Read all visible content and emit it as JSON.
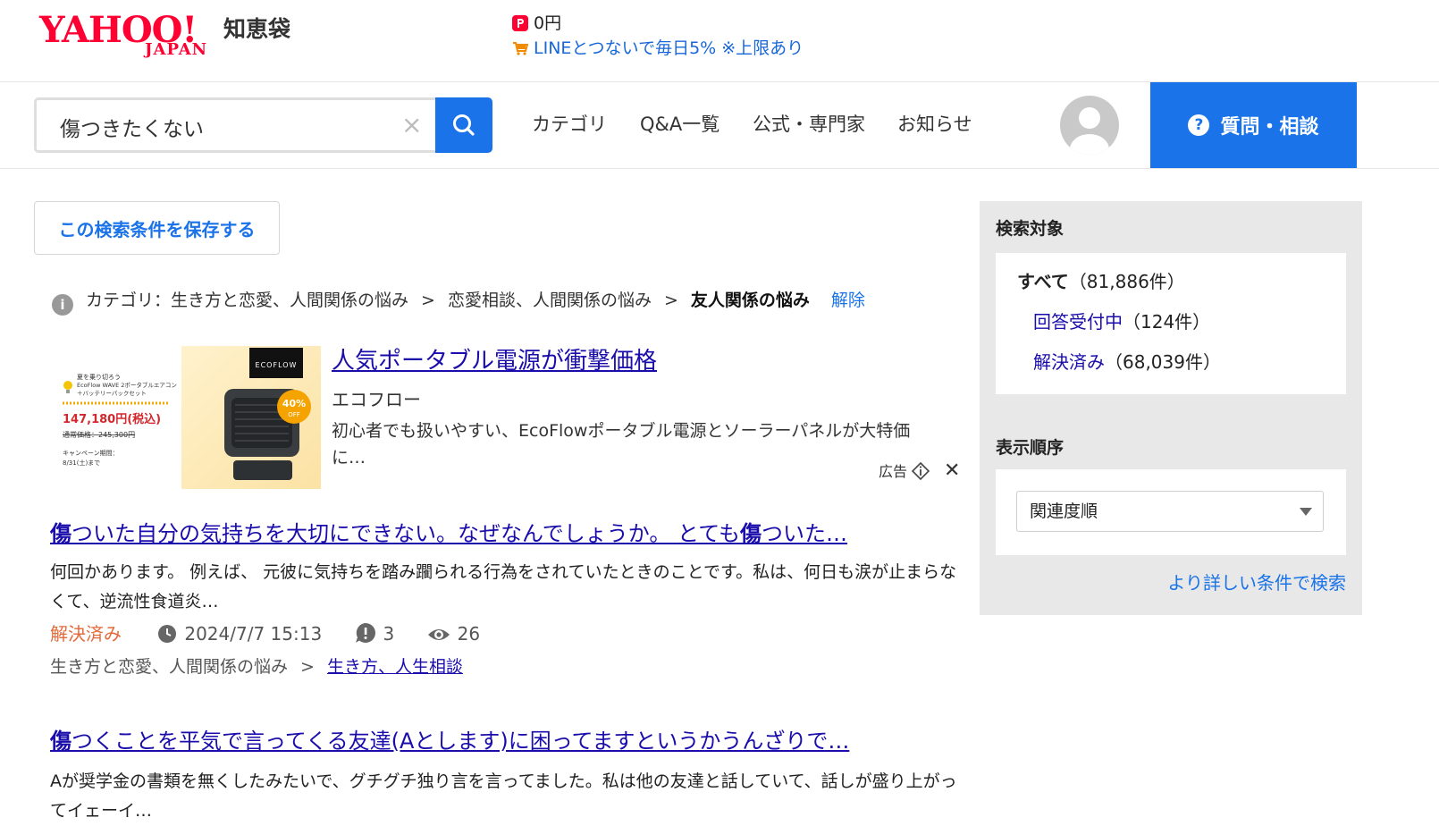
{
  "brand": {
    "logo_text": "YAHOO!",
    "logo_sub": "JAPAN",
    "service": "知恵袋",
    "accent": "#ff0033",
    "primary": "#1a73e8"
  },
  "header": {
    "paypay_balance": "0円",
    "promo_text": "LINEとつないで毎日5% ※上限あり"
  },
  "search": {
    "value": "傷つきたくない",
    "clear_icon": "×"
  },
  "nav": [
    "カテゴリ",
    "Q&A一覧",
    "公式・専門家",
    "お知らせ"
  ],
  "ask_button": "質問・相談",
  "save_search": "この検索条件を保存する",
  "breadcrumb": {
    "prefix": "カテゴリ：",
    "level1": "生き方と恋愛、人間関係の悩み",
    "level2": "恋愛相談、人間関係の悩み",
    "current": "友人関係の悩み",
    "clear": "解除",
    "separator": ">"
  },
  "ad": {
    "title": "人気ポータブル電源が衝撃価格",
    "sponsor": "エコフロー",
    "description": "初心者でも扱いやすい、EcoFlowポータブル電源とソーラーパネルが大特価に…",
    "label": "広告",
    "image_text": {
      "line1": "夏を乗り切ろう",
      "line2": "EcoFlow WAVE 2ポータブルエアコン",
      "line3": "＋バッテリーパックセット",
      "price": "147,180円(税込)",
      "regular": "通常価格：245,300円",
      "campaign": "キャンペーン期間：",
      "until": "8/31(土)まで",
      "brand_logo": "ECOFLOW",
      "discount": "40%",
      "discount_sub": "OFF"
    }
  },
  "results": [
    {
      "title_hl": "傷",
      "title_mid": "ついた自分の気持ちを大切にできない。なぜなんでしょうか。 とても",
      "title_hl2": "傷",
      "title_end": "ついた…",
      "body": "何回かあります。 例えば、 元彼に気持ちを踏み躙られる行為をされていたときのことです。私は、何日も涙が止まらなくて、逆流性食道炎…",
      "status": "解決済み",
      "date": "2024/7/7 15:13",
      "answers": "3",
      "views": "26",
      "category_parent": "生き方と恋愛、人間関係の悩み",
      "category": "生き方、人生相談"
    },
    {
      "title_hl": "傷",
      "title_rest": "つくことを平気で言ってくる友達(Aとします)に困ってますというかうんざりで…",
      "body": "Aが奨学金の書類を無くしたみたいで、グチグチ独り言を言ってました。私は他の友達と話していて、話しが盛り上がってイェーイ…"
    }
  ],
  "sidebar": {
    "target_heading": "検索対象",
    "filters": [
      {
        "label": "すべて",
        "count": "（81,886件）"
      },
      {
        "label": "回答受付中",
        "count": "（124件）"
      },
      {
        "label": "解決済み",
        "count": "（68,039件）"
      }
    ],
    "sort_heading": "表示順序",
    "sort_value": "関連度順",
    "advanced": "より詳しい条件で検索"
  }
}
